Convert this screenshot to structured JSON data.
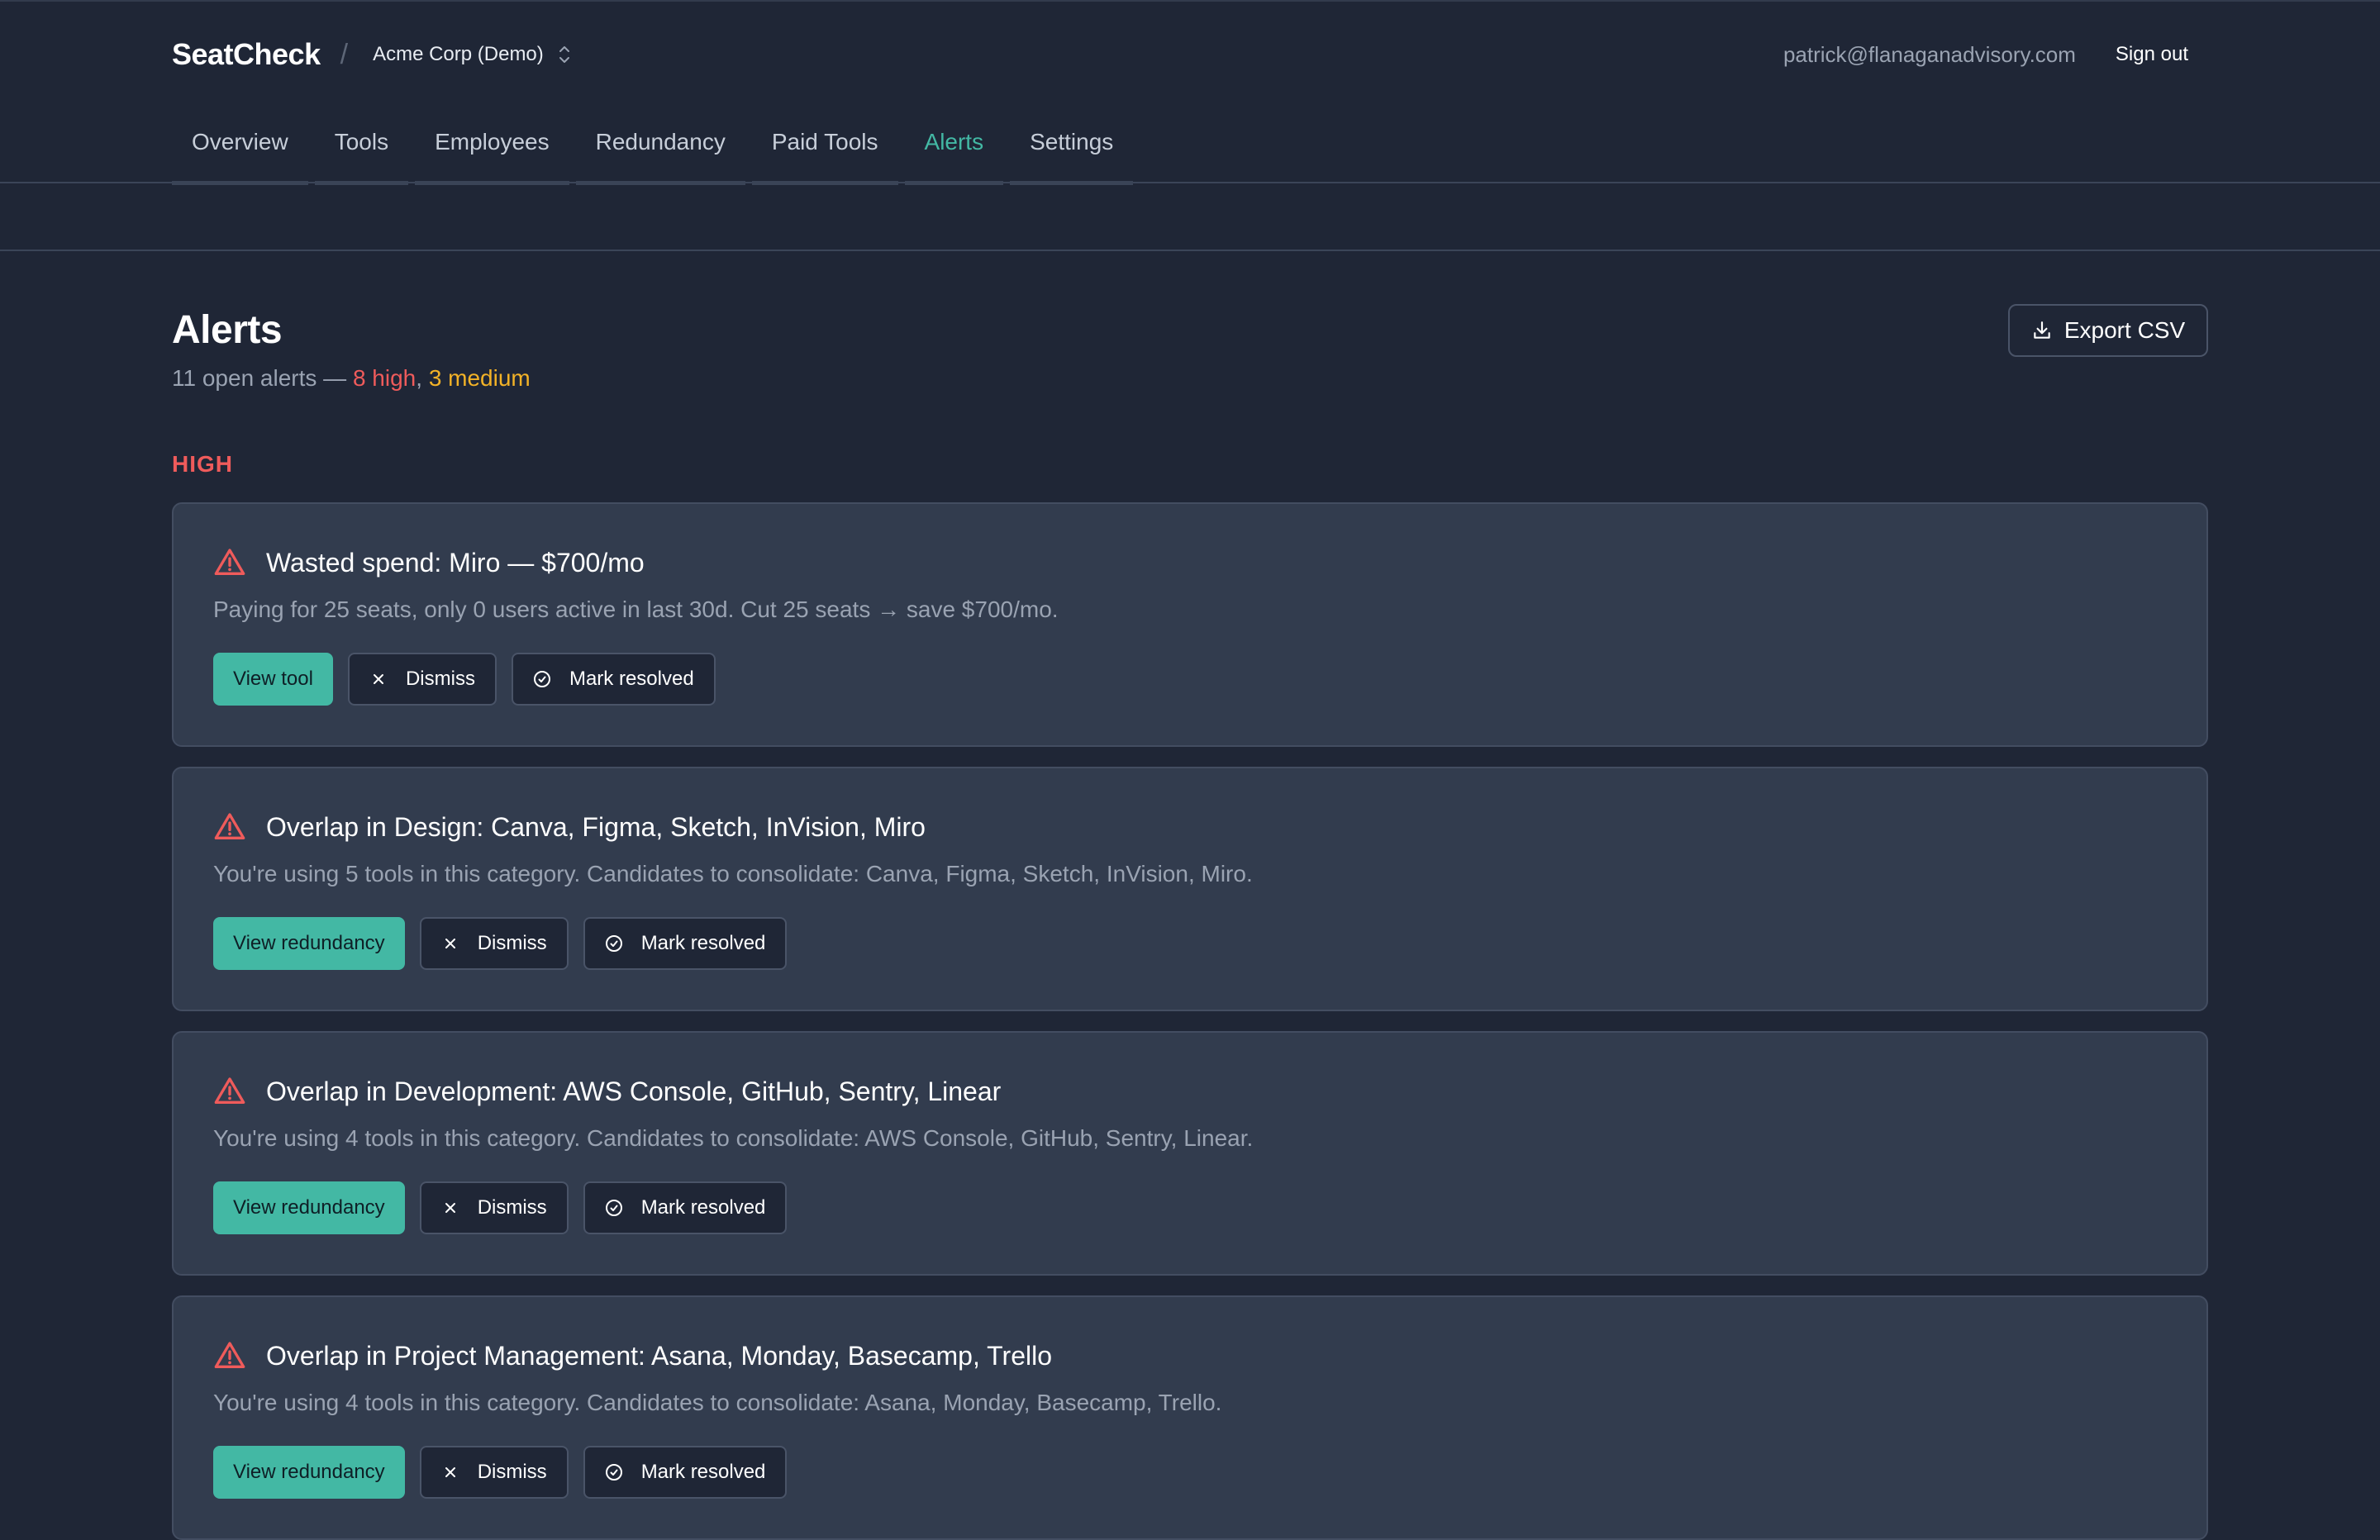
{
  "app": {
    "brand": "SeatCheck",
    "separator": "/",
    "org": "Acme Corp (Demo)",
    "user_email": "patrick@flanaganadvisory.com",
    "sign_out": "Sign out"
  },
  "nav": {
    "tabs": [
      {
        "label": "Overview",
        "active": false
      },
      {
        "label": "Tools",
        "active": false
      },
      {
        "label": "Employees",
        "active": false
      },
      {
        "label": "Redundancy",
        "active": false
      },
      {
        "label": "Paid Tools",
        "active": false
      },
      {
        "label": "Alerts",
        "active": true
      },
      {
        "label": "Settings",
        "active": false
      }
    ]
  },
  "page": {
    "title": "Alerts",
    "summary_prefix": "11 open alerts — ",
    "summary_high": "8 high",
    "summary_sep": ", ",
    "summary_medium": "3 medium",
    "export_label": "Export CSV",
    "section_high": "HIGH"
  },
  "alerts": [
    {
      "title": "Wasted spend: Miro — $700/mo",
      "description": "Paying for 25 seats, only 0 users active in last 30d. Cut 25 seats → save $700/mo.",
      "primary_action": "View tool",
      "dismiss": "Dismiss",
      "resolve": "Mark resolved"
    },
    {
      "title": "Overlap in Design: Canva, Figma, Sketch, InVision, Miro",
      "description": "You're using 5 tools in this category. Candidates to consolidate: Canva, Figma, Sketch, InVision, Miro.",
      "primary_action": "View redundancy",
      "dismiss": "Dismiss",
      "resolve": "Mark resolved"
    },
    {
      "title": "Overlap in Development: AWS Console, GitHub, Sentry, Linear",
      "description": "You're using 4 tools in this category. Candidates to consolidate: AWS Console, GitHub, Sentry, Linear.",
      "primary_action": "View redundancy",
      "dismiss": "Dismiss",
      "resolve": "Mark resolved"
    },
    {
      "title": "Overlap in Project Management: Asana, Monday, Basecamp, Trello",
      "description": "You're using 4 tools in this category. Candidates to consolidate: Asana, Monday, Basecamp, Trello.",
      "primary_action": "View redundancy",
      "dismiss": "Dismiss",
      "resolve": "Mark resolved"
    }
  ],
  "colors": {
    "background": "#1f2636",
    "card": "#323c4e",
    "accent": "#43b8a4",
    "high": "#ef5b5b",
    "medium": "#f2b227"
  },
  "icons": {
    "alert": "warning-triangle-icon",
    "dismiss": "close-icon",
    "resolve": "check-circle-icon",
    "export": "download-icon",
    "org_switch": "chevron-up-down-icon"
  }
}
